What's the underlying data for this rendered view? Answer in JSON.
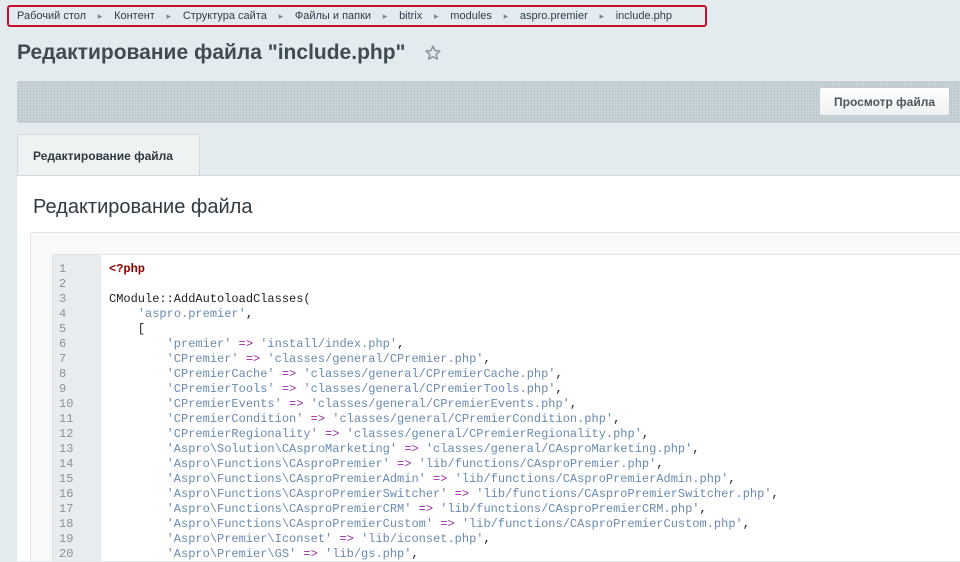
{
  "breadcrumb": {
    "items": [
      "Рабочий стол",
      "Контент",
      "Структура сайта",
      "Файлы и папки",
      "bitrix",
      "modules",
      "aspro.premier",
      "include.php"
    ]
  },
  "page": {
    "title": "Редактирование файла \"include.php\""
  },
  "toolbar": {
    "view_button_label": "Просмотр файла"
  },
  "tabs": [
    {
      "label": "Редактирование файла"
    }
  ],
  "panel": {
    "title": "Редактирование файла"
  },
  "editor": {
    "lines": [
      {
        "n": "1",
        "tokens": [
          {
            "t": "<?php",
            "c": "kw"
          }
        ]
      },
      {
        "n": "2",
        "tokens": []
      },
      {
        "n": "3",
        "tokens": [
          {
            "t": "CModule::AddAutoloadClasses(",
            "c": "plain"
          }
        ]
      },
      {
        "n": "4",
        "tokens": [
          {
            "t": "    ",
            "c": "plain"
          },
          {
            "t": "'aspro.premier'",
            "c": "str"
          },
          {
            "t": ",",
            "c": "plain"
          }
        ]
      },
      {
        "n": "5",
        "tokens": [
          {
            "t": "    [",
            "c": "plain"
          }
        ]
      },
      {
        "n": "6",
        "tokens": [
          {
            "t": "        ",
            "c": "plain"
          },
          {
            "t": "'premier'",
            "c": "str"
          },
          {
            "t": " => ",
            "c": "op"
          },
          {
            "t": "'install/index.php'",
            "c": "str"
          },
          {
            "t": ",",
            "c": "plain"
          }
        ]
      },
      {
        "n": "7",
        "tokens": [
          {
            "t": "        ",
            "c": "plain"
          },
          {
            "t": "'CPremier'",
            "c": "str"
          },
          {
            "t": " => ",
            "c": "op"
          },
          {
            "t": "'classes/general/CPremier.php'",
            "c": "str"
          },
          {
            "t": ",",
            "c": "plain"
          }
        ]
      },
      {
        "n": "8",
        "tokens": [
          {
            "t": "        ",
            "c": "plain"
          },
          {
            "t": "'CPremierCache'",
            "c": "str"
          },
          {
            "t": " => ",
            "c": "op"
          },
          {
            "t": "'classes/general/CPremierCache.php'",
            "c": "str"
          },
          {
            "t": ",",
            "c": "plain"
          }
        ]
      },
      {
        "n": "9",
        "tokens": [
          {
            "t": "        ",
            "c": "plain"
          },
          {
            "t": "'CPremierTools'",
            "c": "str"
          },
          {
            "t": " => ",
            "c": "op"
          },
          {
            "t": "'classes/general/CPremierTools.php'",
            "c": "str"
          },
          {
            "t": ",",
            "c": "plain"
          }
        ]
      },
      {
        "n": "10",
        "tokens": [
          {
            "t": "        ",
            "c": "plain"
          },
          {
            "t": "'CPremierEvents'",
            "c": "str"
          },
          {
            "t": " => ",
            "c": "op"
          },
          {
            "t": "'classes/general/CPremierEvents.php'",
            "c": "str"
          },
          {
            "t": ",",
            "c": "plain"
          }
        ]
      },
      {
        "n": "11",
        "tokens": [
          {
            "t": "        ",
            "c": "plain"
          },
          {
            "t": "'CPremierCondition'",
            "c": "str"
          },
          {
            "t": " => ",
            "c": "op"
          },
          {
            "t": "'classes/general/CPremierCondition.php'",
            "c": "str"
          },
          {
            "t": ",",
            "c": "plain"
          }
        ]
      },
      {
        "n": "12",
        "tokens": [
          {
            "t": "        ",
            "c": "plain"
          },
          {
            "t": "'CPremierRegionality'",
            "c": "str"
          },
          {
            "t": " => ",
            "c": "op"
          },
          {
            "t": "'classes/general/CPremierRegionality.php'",
            "c": "str"
          },
          {
            "t": ",",
            "c": "plain"
          }
        ]
      },
      {
        "n": "13",
        "tokens": [
          {
            "t": "        ",
            "c": "plain"
          },
          {
            "t": "'Aspro\\Solution\\CAsproMarketing'",
            "c": "str"
          },
          {
            "t": " => ",
            "c": "op"
          },
          {
            "t": "'classes/general/CAsproMarketing.php'",
            "c": "str"
          },
          {
            "t": ",",
            "c": "plain"
          }
        ]
      },
      {
        "n": "14",
        "tokens": [
          {
            "t": "        ",
            "c": "plain"
          },
          {
            "t": "'Aspro\\Functions\\CAsproPremier'",
            "c": "str"
          },
          {
            "t": " => ",
            "c": "op"
          },
          {
            "t": "'lib/functions/CAsproPremier.php'",
            "c": "str"
          },
          {
            "t": ",",
            "c": "plain"
          }
        ]
      },
      {
        "n": "15",
        "tokens": [
          {
            "t": "        ",
            "c": "plain"
          },
          {
            "t": "'Aspro\\Functions\\CAsproPremierAdmin'",
            "c": "str"
          },
          {
            "t": " => ",
            "c": "op"
          },
          {
            "t": "'lib/functions/CAsproPremierAdmin.php'",
            "c": "str"
          },
          {
            "t": ",",
            "c": "plain"
          }
        ]
      },
      {
        "n": "16",
        "tokens": [
          {
            "t": "        ",
            "c": "plain"
          },
          {
            "t": "'Aspro\\Functions\\CAsproPremierSwitcher'",
            "c": "str"
          },
          {
            "t": " => ",
            "c": "op"
          },
          {
            "t": "'lib/functions/CAsproPremierSwitcher.php'",
            "c": "str"
          },
          {
            "t": ",",
            "c": "plain"
          }
        ]
      },
      {
        "n": "17",
        "tokens": [
          {
            "t": "        ",
            "c": "plain"
          },
          {
            "t": "'Aspro\\Functions\\CAsproPremierCRM'",
            "c": "str"
          },
          {
            "t": " => ",
            "c": "op"
          },
          {
            "t": "'lib/functions/CAsproPremierCRM.php'",
            "c": "str"
          },
          {
            "t": ",",
            "c": "plain"
          }
        ]
      },
      {
        "n": "18",
        "tokens": [
          {
            "t": "        ",
            "c": "plain"
          },
          {
            "t": "'Aspro\\Functions\\CAsproPremierCustom'",
            "c": "str"
          },
          {
            "t": " => ",
            "c": "op"
          },
          {
            "t": "'lib/functions/CAsproPremierCustom.php'",
            "c": "str"
          },
          {
            "t": ",",
            "c": "plain"
          }
        ]
      },
      {
        "n": "19",
        "tokens": [
          {
            "t": "        ",
            "c": "plain"
          },
          {
            "t": "'Aspro\\Premier\\Iconset'",
            "c": "str"
          },
          {
            "t": " => ",
            "c": "op"
          },
          {
            "t": "'lib/iconset.php'",
            "c": "str"
          },
          {
            "t": ",",
            "c": "plain"
          }
        ]
      },
      {
        "n": "20",
        "tokens": [
          {
            "t": "        ",
            "c": "plain"
          },
          {
            "t": "'Aspro\\Premier\\GS'",
            "c": "str"
          },
          {
            "t": " => ",
            "c": "op"
          },
          {
            "t": "'lib/gs.php'",
            "c": "str"
          },
          {
            "t": ",",
            "c": "plain"
          }
        ]
      }
    ]
  }
}
